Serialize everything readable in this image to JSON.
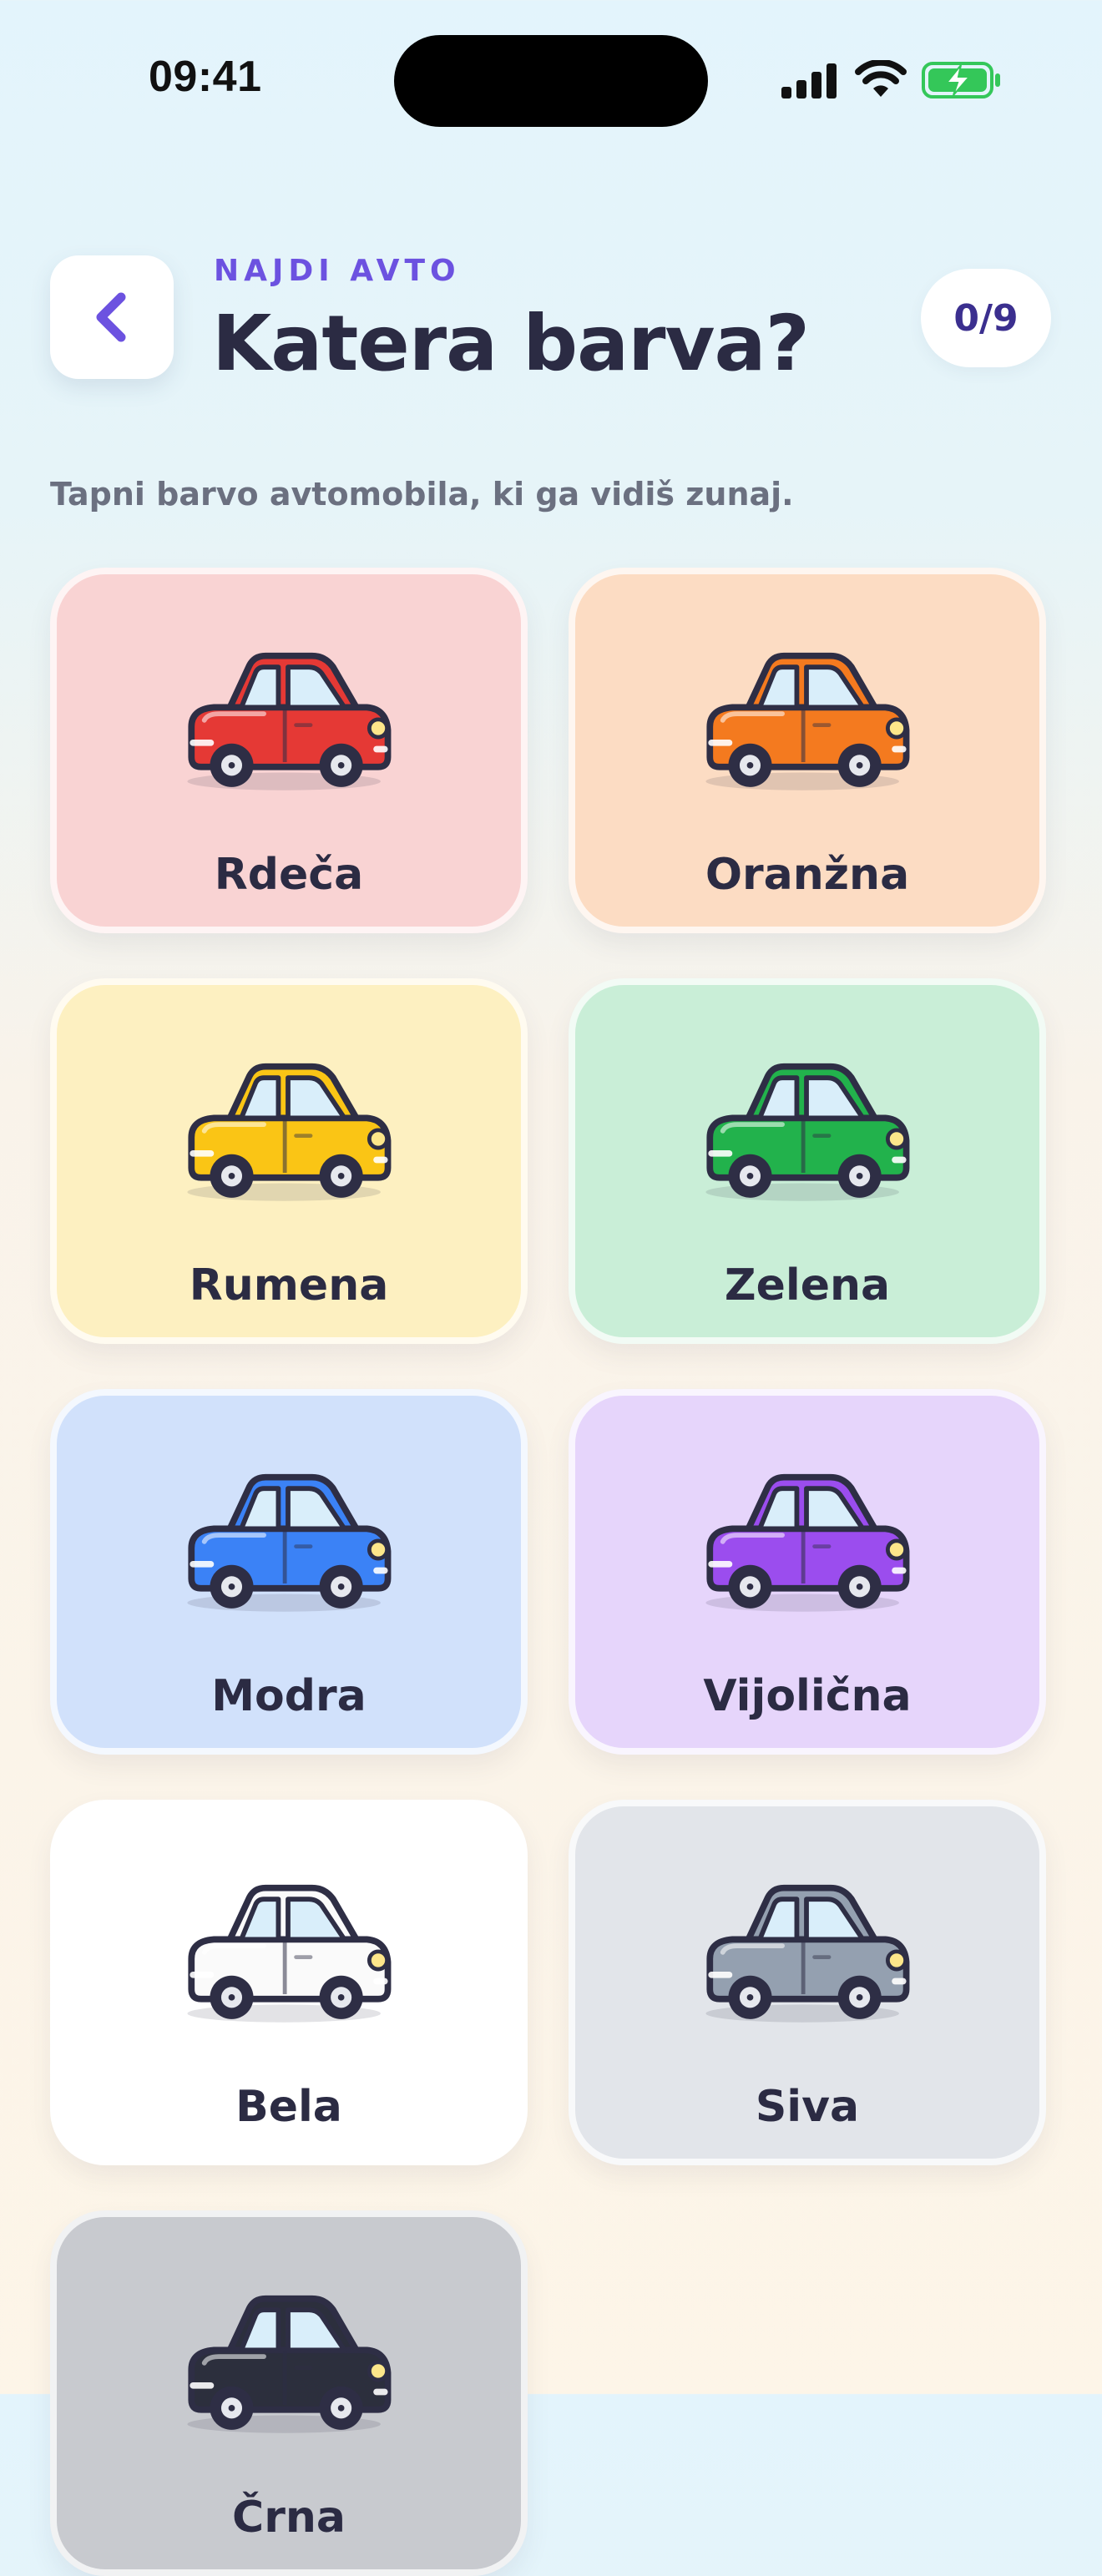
{
  "status_bar": {
    "time": "09:41"
  },
  "header": {
    "eyebrow": "NAJDI AVTO",
    "title": "Katera barva?",
    "progress": "0/9",
    "back_icon": "chevron-left-icon"
  },
  "subtitle": "Tapni barvo avtomobila, ki ga vidiš zunaj.",
  "colors": [
    {
      "label": "Rdeča",
      "car_color": "#e53935",
      "card_bg": "#f9d3d3"
    },
    {
      "label": "Oranžna",
      "car_color": "#f47a1f",
      "card_bg": "#fcdcc3"
    },
    {
      "label": "Rumena",
      "car_color": "#fac515",
      "card_bg": "#fdf0c1"
    },
    {
      "label": "Zelena",
      "car_color": "#22b24c",
      "card_bg": "#c9eed7"
    },
    {
      "label": "Modra",
      "car_color": "#3b82f6",
      "card_bg": "#d1e1fb"
    },
    {
      "label": "Vijolična",
      "car_color": "#9b4dee",
      "card_bg": "#e6d5fb"
    },
    {
      "label": "Bela",
      "car_color": "#fafafa",
      "card_bg": "#ffffff"
    },
    {
      "label": "Siva",
      "car_color": "#94a0b0",
      "card_bg": "#e2e5ea"
    },
    {
      "label": "Črna",
      "car_color": "#2c2f3d",
      "card_bg": "#c8cacf"
    }
  ],
  "accent_color": "#6c52e0"
}
